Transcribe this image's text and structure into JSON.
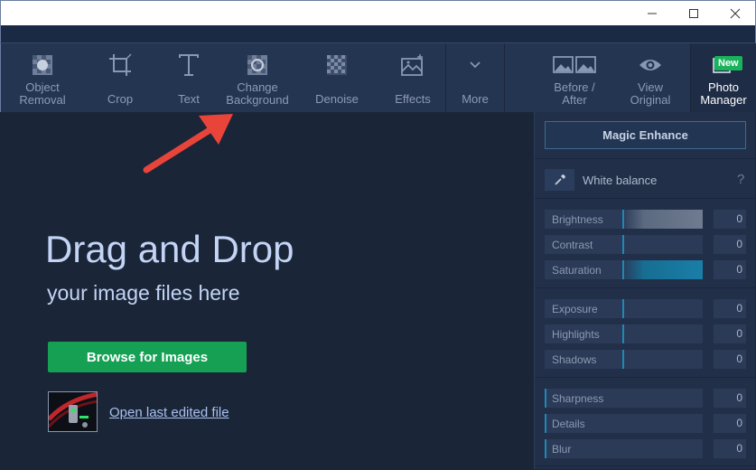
{
  "toolbar": {
    "tools": [
      {
        "label": "Object\nRemoval",
        "icon": "object-removal-icon"
      },
      {
        "label": "Crop",
        "icon": "crop-icon"
      },
      {
        "label": "Text",
        "icon": "text-icon"
      },
      {
        "label": "Change\nBackground",
        "icon": "change-background-icon"
      },
      {
        "label": "Denoise",
        "icon": "denoise-icon"
      },
      {
        "label": "Effects",
        "icon": "effects-icon"
      },
      {
        "label": "More",
        "icon": "chevron-down-icon"
      },
      {
        "label": "Before /\nAfter",
        "icon": "before-after-icon"
      },
      {
        "label": "View\nOriginal",
        "icon": "eye-icon"
      },
      {
        "label": "Photo\nManager",
        "icon": "photo-manager-icon"
      }
    ],
    "new_badge": "New"
  },
  "main": {
    "title": "Drag and Drop",
    "subtitle": "your image files here",
    "browse_label": "Browse for Images",
    "open_last_label": "Open last edited file"
  },
  "panel": {
    "magic_enhance": "Magic Enhance",
    "white_balance": "White balance",
    "help": "?",
    "groups": [
      [
        {
          "label": "Brightness",
          "value": "0"
        },
        {
          "label": "Contrast",
          "value": "0"
        },
        {
          "label": "Saturation",
          "value": "0"
        }
      ],
      [
        {
          "label": "Exposure",
          "value": "0"
        },
        {
          "label": "Highlights",
          "value": "0"
        },
        {
          "label": "Shadows",
          "value": "0"
        }
      ],
      [
        {
          "label": "Sharpness",
          "value": "0"
        },
        {
          "label": "Details",
          "value": "0"
        },
        {
          "label": "Blur",
          "value": "0"
        }
      ]
    ]
  },
  "colors": {
    "accent_green": "#15a054",
    "slider_accent": "#1e88b8",
    "arrow_red": "#e8443a"
  }
}
